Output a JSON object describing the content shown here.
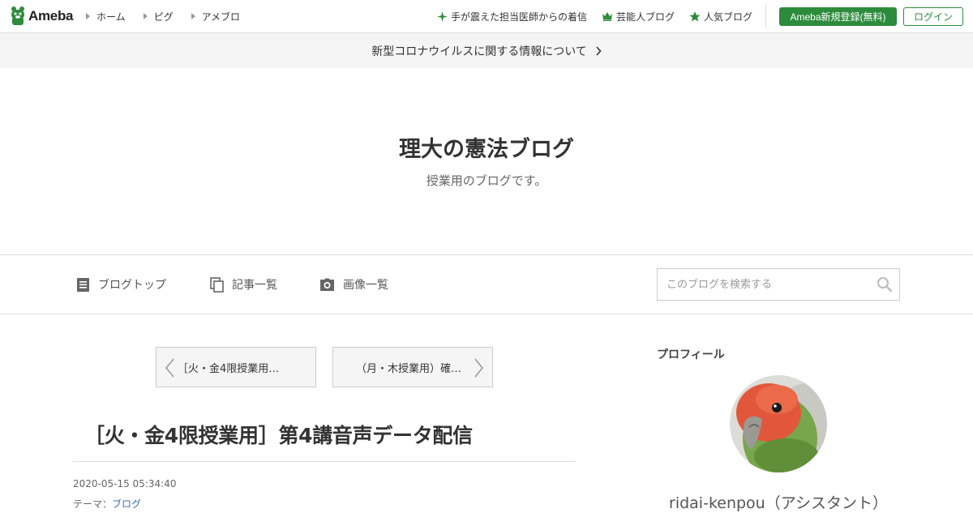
{
  "header": {
    "logo_text": "Ameba",
    "nav_left": [
      {
        "label": "ホーム"
      },
      {
        "label": "ピグ"
      },
      {
        "label": "アメブロ"
      }
    ],
    "nav_right": [
      {
        "label": "手が震えた担当医師からの着信",
        "icon": "sparkle-icon"
      },
      {
        "label": "芸能人ブログ",
        "icon": "crown-icon"
      },
      {
        "label": "人気ブログ",
        "icon": "star-icon"
      }
    ],
    "register_label": "Ameba新規登録(無料)",
    "login_label": "ログイン"
  },
  "notice": {
    "text": "新型コロナウイルスに関する情報について"
  },
  "blog": {
    "title": "理大の憲法ブログ",
    "description": "授業用のブログです。"
  },
  "blog_nav": {
    "items": [
      {
        "label": "ブログトップ",
        "icon": "document-icon"
      },
      {
        "label": "記事一覧",
        "icon": "copy-icon"
      },
      {
        "label": "画像一覧",
        "icon": "camera-icon"
      }
    ],
    "search_placeholder": "このブログを検索する"
  },
  "article_nav": {
    "prev_label": "［火・金4限授業用…",
    "next_label": "（月・木授業用）確…"
  },
  "entry": {
    "title": "［火・金4限授業用］第4講音声データ配信",
    "date": "2020-05-15 05:34:40",
    "theme_label": "テーマ：",
    "theme_value": "ブログ"
  },
  "sidebar": {
    "profile_heading": "プロフィール",
    "profile_name": "ridai-kenpou（アシスタント）"
  },
  "colors": {
    "brand_green": "#2d8c3c",
    "link_blue": "#3c6cb4",
    "notice_bg": "#f5f5f5"
  }
}
